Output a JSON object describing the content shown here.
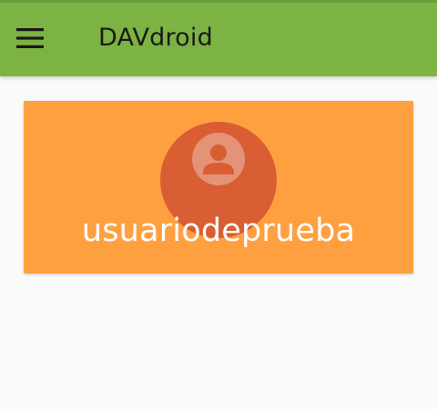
{
  "app_bar": {
    "title": "DAVdroid",
    "menu_icon": "hamburger-menu-icon",
    "color": "#7cb342"
  },
  "account_card": {
    "account_name": "usuariodeprueba",
    "avatar_icon": "account-circle-icon",
    "card_color": "#ffa040",
    "avatar_color": "#d95e33"
  },
  "background_color": "#fafafa"
}
